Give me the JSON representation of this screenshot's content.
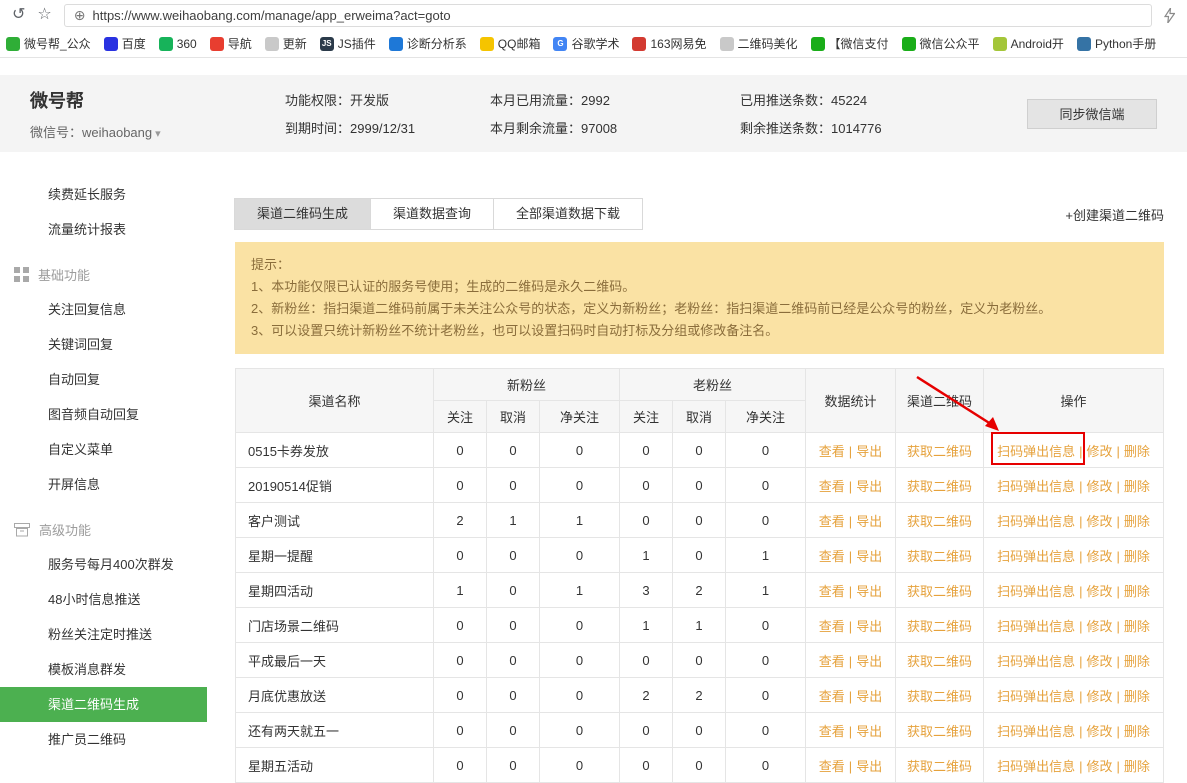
{
  "colors": {
    "sidebar_active": "#4cb050",
    "link": "#e6a23c",
    "notice_bg": "#fae2a4",
    "notice_text": "#8a6d3b",
    "annotation": "#e60000",
    "header_band_bg": "#f4f4f4",
    "tab_active_bg": "#dcdcdc"
  },
  "browser": {
    "url": "https://www.weihaobang.com/manage/app_erweima?act=goto",
    "bookmarks": [
      {
        "label": "微号帮_公众",
        "color": "#2fae37",
        "glyph": ""
      },
      {
        "label": "百度",
        "color": "#2932e1",
        "glyph": ""
      },
      {
        "label": "360",
        "color": "#17b35a",
        "glyph": ""
      },
      {
        "label": "导航",
        "color": "#e83e30",
        "glyph": ""
      },
      {
        "label": "更新",
        "color": "#c9c9c9",
        "glyph": ""
      },
      {
        "label": "JS插件",
        "color": "#2b3a4a",
        "glyph": "JS"
      },
      {
        "label": "诊断分析系",
        "color": "#1e78d7",
        "glyph": ""
      },
      {
        "label": "QQ邮箱",
        "color": "#f5c400",
        "glyph": ""
      },
      {
        "label": "谷歌学术",
        "color": "#4285f4",
        "glyph": "G"
      },
      {
        "label": "163网易免",
        "color": "#d33a31",
        "glyph": ""
      },
      {
        "label": "二维码美化",
        "color": "#c9c9c9",
        "glyph": ""
      },
      {
        "label": "【微信支付",
        "color": "#1aad19",
        "glyph": ""
      },
      {
        "label": "微信公众平",
        "color": "#1aad19",
        "glyph": ""
      },
      {
        "label": "Android开",
        "color": "#a4c639",
        "glyph": ""
      },
      {
        "label": "Python手册",
        "color": "#3573a5",
        "glyph": ""
      }
    ]
  },
  "header": {
    "brand": "微号帮",
    "account_text": "微信号：weihaobang",
    "stat_columns": [
      {
        "rows": [
          "功能权限：开发版",
          "到期时间：2999/12/31"
        ]
      },
      {
        "rows": [
          "本月已用流量：2992",
          "本月剩余流量：97008"
        ]
      },
      {
        "rows": [
          "已用推送条数：45224",
          "剩余推送条数：1014776"
        ]
      }
    ],
    "sync_button": "同步微信端"
  },
  "sidebar": {
    "items": [
      {
        "label": "续费延长服务",
        "type": "link"
      },
      {
        "label": "流量统计报表",
        "type": "link"
      },
      {
        "label": "基础功能",
        "type": "section",
        "icon": "grid-icon"
      },
      {
        "label": "关注回复信息",
        "type": "link"
      },
      {
        "label": "关键词回复",
        "type": "link"
      },
      {
        "label": "自动回复",
        "type": "link"
      },
      {
        "label": "图音频自动回复",
        "type": "link"
      },
      {
        "label": "自定义菜单",
        "type": "link"
      },
      {
        "label": "开屏信息",
        "type": "link"
      },
      {
        "label": "高级功能",
        "type": "section",
        "icon": "archive-icon"
      },
      {
        "label": "服务号每月400次群发",
        "type": "link"
      },
      {
        "label": "48小时信息推送",
        "type": "link"
      },
      {
        "label": "粉丝关注定时推送",
        "type": "link"
      },
      {
        "label": "模板消息群发",
        "type": "link"
      },
      {
        "label": "渠道二维码生成",
        "type": "link",
        "active": true
      },
      {
        "label": "推广员二维码",
        "type": "link"
      }
    ]
  },
  "main": {
    "tabs": [
      {
        "label": "渠道二维码生成",
        "active": true
      },
      {
        "label": "渠道数据查询",
        "active": false
      },
      {
        "label": "全部渠道数据下载",
        "active": false
      }
    ],
    "create_link": "+创建渠道二维码",
    "notice": {
      "title": "提示：",
      "lines": [
        "1、本功能仅限已认证的服务号使用；生成的二维码是永久二维码。",
        "2、新粉丝：指扫渠道二维码前属于未关注公众号的状态，定义为新粉丝；老粉丝：指扫渠道二维码前已经是公众号的粉丝，定义为老粉丝。",
        "3、可以设置只统计新粉丝不统计老粉丝，也可以设置扫码时自动打标及分组或修改备注名。"
      ]
    },
    "table": {
      "sep": "|",
      "header": {
        "name": "渠道名称",
        "new_fans": "新粉丝",
        "old_fans": "老粉丝",
        "sub_cols": [
          "关注",
          "取消",
          "净关注"
        ],
        "stats": "数据统计",
        "qrcode": "渠道二维码",
        "ops": "操作"
      },
      "stats_links": [
        "查看",
        "导出"
      ],
      "qrcode_link": "获取二维码",
      "ops_links": [
        "扫码弹出信息",
        "修改",
        "删除"
      ],
      "rows": [
        {
          "name": "0515卡券发放",
          "values": [
            0,
            0,
            0,
            0,
            0,
            0
          ]
        },
        {
          "name": "20190514促销",
          "values": [
            0,
            0,
            0,
            0,
            0,
            0
          ]
        },
        {
          "name": "客户测试",
          "values": [
            2,
            1,
            1,
            0,
            0,
            0
          ]
        },
        {
          "name": "星期一提醒",
          "values": [
            0,
            0,
            0,
            1,
            0,
            1
          ]
        },
        {
          "name": "星期四活动",
          "values": [
            1,
            0,
            1,
            3,
            2,
            1
          ]
        },
        {
          "name": "门店场景二维码",
          "values": [
            0,
            0,
            0,
            1,
            1,
            0
          ]
        },
        {
          "name": "平成最后一天",
          "values": [
            0,
            0,
            0,
            0,
            0,
            0
          ]
        },
        {
          "name": "月底优惠放送",
          "values": [
            0,
            0,
            0,
            2,
            2,
            0
          ]
        },
        {
          "name": "还有两天就五一",
          "values": [
            0,
            0,
            0,
            0,
            0,
            0
          ]
        },
        {
          "name": "星期五活动",
          "values": [
            0,
            0,
            0,
            0,
            0,
            0
          ]
        }
      ]
    }
  }
}
